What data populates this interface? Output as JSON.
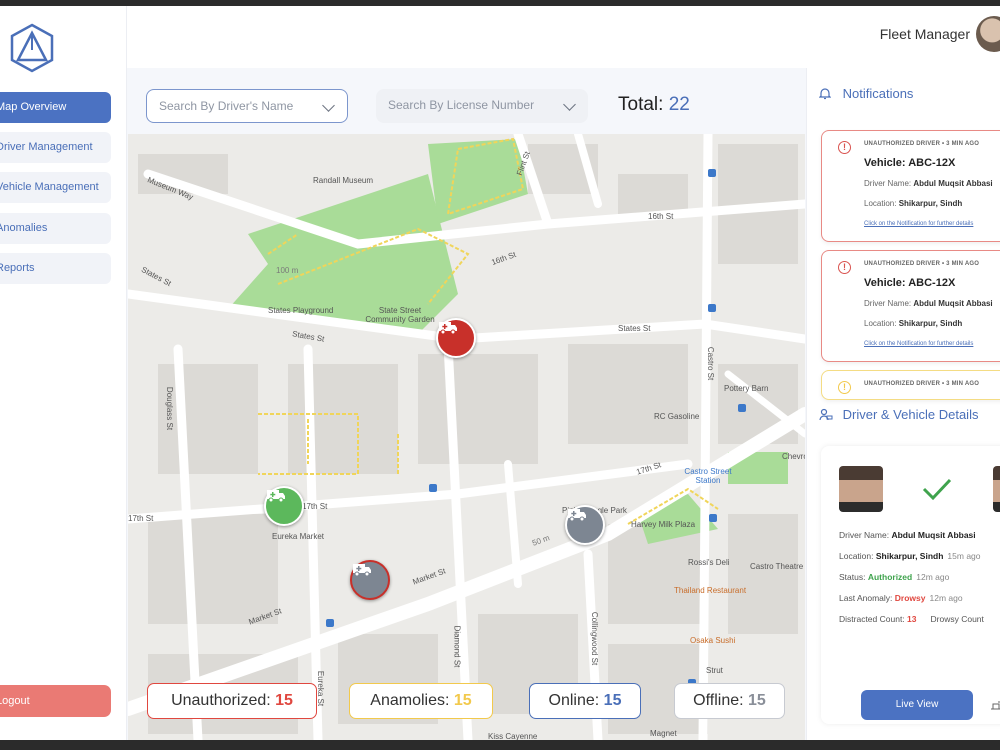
{
  "sidebar": {
    "items": [
      {
        "label": "Map Overview",
        "active": true
      },
      {
        "label": "Driver Management"
      },
      {
        "label": "Vehicle Management"
      },
      {
        "label": "Anomalies"
      },
      {
        "label": "Reports"
      }
    ],
    "logout_label": "Logout"
  },
  "header": {
    "title": "Fleet Manager"
  },
  "filters": {
    "driver_placeholder": "Search By Driver's Name",
    "license_placeholder": "Search By License Number"
  },
  "total": {
    "label": "Total:",
    "value": "22"
  },
  "map_labels": {
    "museum": "Randall Museum",
    "museum_way": "Museum Way",
    "st16": "16th St",
    "st16b": "16th St",
    "flint": "Flint St",
    "states1": "States St",
    "states2": "States St",
    "states3": "States St",
    "playground": "States Playground",
    "garden": "State Street Community Garden",
    "castro_st": "Castro St",
    "pottery": "Pottery Barn",
    "rc": "RC Gasoline",
    "douglass": "Douglass St",
    "st17": "17th St",
    "st17b": "17th St",
    "st17c": "17th St",
    "eureka_market": "Eureka Market",
    "castro_station": "Castro Street Station",
    "pink_park": "Pink Triangle Park",
    "harvey": "Harvey Milk Plaza",
    "chevron": "Chevron",
    "market1": "Market St",
    "market2": "Market St",
    "rossis": "Rossi's Deli",
    "castro_theatre": "Castro Theatre",
    "thailand": "Thailand Restaurant",
    "diamond": "Diamond St",
    "collingwood": "Collingwood St",
    "eureka_st": "Eureka St",
    "osaka": "Osaka Sushi",
    "strut": "Strut",
    "magnet": "Magnet",
    "caffe": "Kiss Cayenne",
    "m50": "50 m",
    "m100": "100 m"
  },
  "counts": {
    "unauthorized": {
      "label": "Unauthorized:",
      "value": "15",
      "color": "#e0473f"
    },
    "anomalies": {
      "label": "Anamolies:",
      "value": "15",
      "color": "#f2c94c"
    },
    "online": {
      "label": "Online:",
      "value": "15",
      "color": "#4a6fb8"
    },
    "offline": {
      "label": "Offline:",
      "value": "15",
      "color": "#8a8f99"
    }
  },
  "notifications": {
    "title": "Notifications",
    "items": [
      {
        "tag": "UNAUTHORIZED DRIVER",
        "time": "• 3 MIN AGO",
        "vehicle": "Vehicle: ABC-12X",
        "driver_label": "Driver Name:",
        "driver": "Abdul Muqsit Abbasi",
        "location_label": "Location:",
        "location": "Shikarpur, Sindh",
        "hint": "Click on the Notification for further details"
      },
      {
        "tag": "UNAUTHORIZED DRIVER",
        "time": "• 3 MIN AGO",
        "vehicle": "Vehicle: ABC-12X",
        "driver_label": "Driver Name:",
        "driver": "Abdul Muqsit Abbasi",
        "location_label": "Location:",
        "location": "Shikarpur, Sindh",
        "hint": "Click on the Notification for further details"
      },
      {
        "tag": "UNAUTHORIZED DRIVER",
        "time": "• 3 MIN AGO"
      }
    ]
  },
  "details": {
    "title": "Driver & Vehicle Details",
    "driver_label": "Driver Name:",
    "driver": "Abdul Muqsit Abbasi",
    "location_label": "Location:",
    "location": "Shikarpur, Sindh",
    "location_ago": "15m ago",
    "status_label": "Status:",
    "status": "Authorized",
    "status_ago": "12m ago",
    "anomaly_label": "Last Anomaly:",
    "anomaly": "Drowsy",
    "anomaly_ago": "12m ago",
    "distracted_label": "Distracted Count:",
    "distracted": "13",
    "drowsy_label": "Drowsy Count",
    "live_view_label": "Live View"
  },
  "colors": {
    "accent": "#4b72c2",
    "danger": "#e0473f",
    "logout": "#ea7a74",
    "online_marker": "#5cb85c",
    "offline_marker": "#7d8692"
  }
}
